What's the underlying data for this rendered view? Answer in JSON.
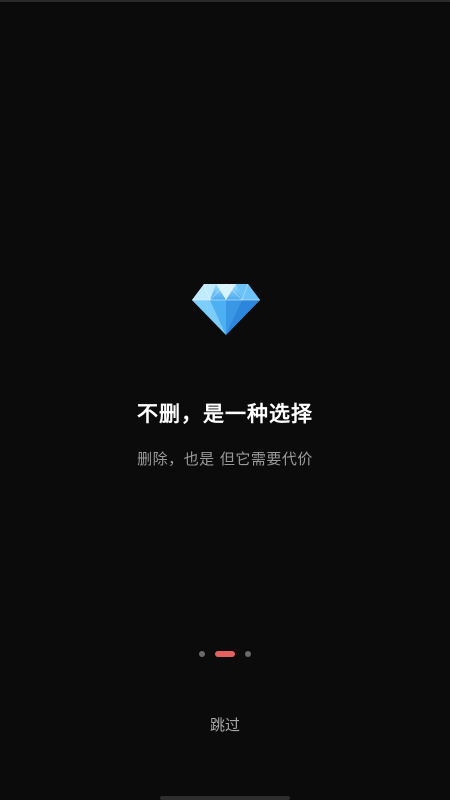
{
  "onboarding": {
    "title": "不删，是一种选择",
    "subtitle": "删除，也是 但它需要代价",
    "skip_label": "跳过",
    "icon": "diamond-icon"
  },
  "pager": {
    "total": 3,
    "current": 2,
    "active_color": "#e46060",
    "inactive_color": "#6b6b6b"
  },
  "colors": {
    "background": "#0b0b0b",
    "title": "#ffffff",
    "subtitle": "#9a9a9a"
  }
}
